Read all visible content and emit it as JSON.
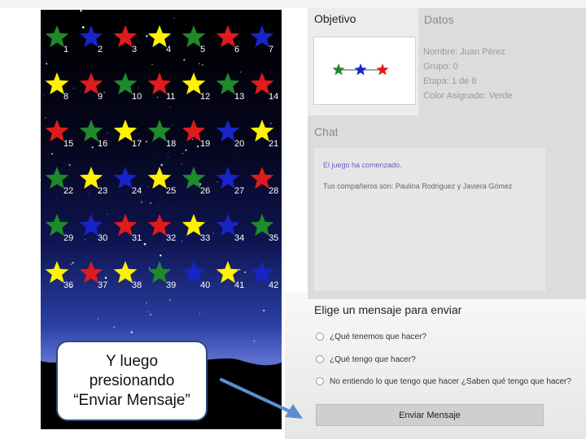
{
  "game": {
    "star_rows": [
      [
        {
          "n": "1",
          "c": "green"
        },
        {
          "n": "2",
          "c": "blue"
        },
        {
          "n": "3",
          "c": "red"
        },
        {
          "n": "4",
          "c": "yellow"
        },
        {
          "n": "5",
          "c": "green"
        },
        {
          "n": "6",
          "c": "red"
        },
        {
          "n": "7",
          "c": "blue"
        }
      ],
      [
        {
          "n": "8",
          "c": "yellow"
        },
        {
          "n": "9",
          "c": "red"
        },
        {
          "n": "10",
          "c": "green"
        },
        {
          "n": "11",
          "c": "red"
        },
        {
          "n": "12",
          "c": "yellow"
        },
        {
          "n": "13",
          "c": "green"
        },
        {
          "n": "14",
          "c": "red"
        }
      ],
      [
        {
          "n": "15",
          "c": "red"
        },
        {
          "n": "16",
          "c": "green"
        },
        {
          "n": "17",
          "c": "yellow"
        },
        {
          "n": "18",
          "c": "green"
        },
        {
          "n": "19",
          "c": "red"
        },
        {
          "n": "20",
          "c": "blue"
        },
        {
          "n": "21",
          "c": "yellow"
        }
      ],
      [
        {
          "n": "22",
          "c": "green"
        },
        {
          "n": "23",
          "c": "yellow"
        },
        {
          "n": "24",
          "c": "blue"
        },
        {
          "n": "25",
          "c": "yellow"
        },
        {
          "n": "26",
          "c": "green"
        },
        {
          "n": "27",
          "c": "blue"
        },
        {
          "n": "28",
          "c": "red"
        }
      ],
      [
        {
          "n": "29",
          "c": "green"
        },
        {
          "n": "30",
          "c": "blue"
        },
        {
          "n": "31",
          "c": "red"
        },
        {
          "n": "32",
          "c": "red"
        },
        {
          "n": "33",
          "c": "yellow"
        },
        {
          "n": "34",
          "c": "blue"
        },
        {
          "n": "35",
          "c": "green"
        }
      ],
      [
        {
          "n": "36",
          "c": "yellow"
        },
        {
          "n": "37",
          "c": "red"
        },
        {
          "n": "38",
          "c": "yellow"
        },
        {
          "n": "39",
          "c": "green"
        },
        {
          "n": "40",
          "c": "blue"
        },
        {
          "n": "41",
          "c": "yellow"
        },
        {
          "n": "42",
          "c": "blue"
        }
      ]
    ]
  },
  "colors": {
    "green": "#1f8a2a",
    "blue": "#1624c8",
    "red": "#e01b1b",
    "yellow": "#fff200",
    "chat_system": "#6a5bc4",
    "arrow": "#5b8ed1",
    "callout_border": "#2e4a73"
  },
  "objetivo": {
    "label": "Objetivo",
    "target_stars": [
      "green",
      "blue",
      "red"
    ]
  },
  "datos": {
    "label": "Datos",
    "nombre": "Nombre: Juan Pérez",
    "grupo": "Grupo: 0",
    "etapa": "Etapa: 1 de 8",
    "color": "Color Asignado: Verde"
  },
  "chat": {
    "label": "Chat",
    "system_msg": "El juego ha comenzado.",
    "msg": "Tus compañeros son: Paulina Rodriguez y Javiera Gómez"
  },
  "messages": {
    "label": "Elige un mensaje para enviar",
    "options": [
      "¿Qué tenemos que hacer?",
      "¿Qué tengo que hacer?",
      "No entiendo lo que tengo que hacer ¿Saben qué tengo que hacer?"
    ],
    "send_label": "Enviar Mensaje"
  },
  "callout": {
    "line1": "Y luego",
    "line2": "presionando",
    "line3": "“Enviar Mensaje”"
  }
}
